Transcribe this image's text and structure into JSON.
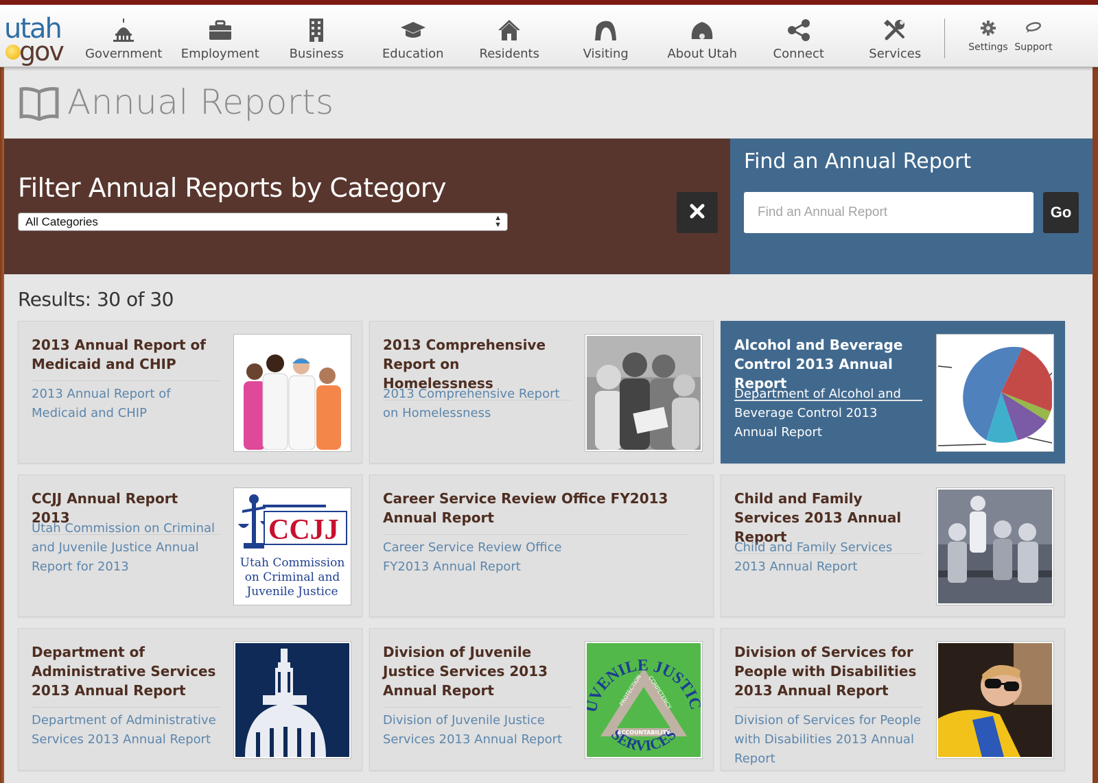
{
  "nav": {
    "items": [
      {
        "label": "Government",
        "icon": "capitol-icon"
      },
      {
        "label": "Employment",
        "icon": "briefcase-icon"
      },
      {
        "label": "Business",
        "icon": "building-icon"
      },
      {
        "label": "Education",
        "icon": "graduation-cap-icon"
      },
      {
        "label": "Residents",
        "icon": "house-icon"
      },
      {
        "label": "Visiting",
        "icon": "arch-icon"
      },
      {
        "label": "About Utah",
        "icon": "beehive-icon"
      },
      {
        "label": "Connect",
        "icon": "share-icon"
      },
      {
        "label": "Services",
        "icon": "tools-icon"
      }
    ],
    "settings_label": "Settings",
    "support_label": "Support"
  },
  "logo": {
    "line1": "utah",
    "line2": "gov"
  },
  "page": {
    "title": "Annual Reports"
  },
  "filter": {
    "heading": "Filter Annual Reports by Category",
    "selected": "All Categories"
  },
  "search": {
    "heading": "Find an Annual Report",
    "placeholder": "Find an Annual Report",
    "go_label": "Go"
  },
  "results": {
    "count_text": "Results: 30 of 30",
    "cards": [
      {
        "title": "2013 Annual Report of Medicaid and CHIP",
        "description": "2013 Annual Report of Medicaid and CHIP",
        "image": "medical-staff-photo"
      },
      {
        "title": "2013 Comprehensive Report on Homelessness",
        "description": "2013 Comprehensive Report on Homelessness",
        "image": "children-reading-photo"
      },
      {
        "title": "Alcohol and Beverage Control 2013 Annual Report",
        "description": "Department of Alcohol and Beverage Control 2013 Annual Report",
        "image": "pie-chart-image"
      },
      {
        "title": "CCJJ Annual Report 2013",
        "description": "Utah Commission on Criminal and Juvenile Justice Annual Report for 2013",
        "image": "ccjj-logo"
      },
      {
        "title": "Career Service Review Office FY2013 Annual Report",
        "description": "Career Service Review Office FY2013 Annual Report",
        "image": ""
      },
      {
        "title": "Child and Family Services 2013 Annual Report",
        "description": "Child and Family Services 2013 Annual Report",
        "image": "family-photo"
      },
      {
        "title": "Department of Administrative Services 2013 Annual Report",
        "description": "Department of Administrative Services 2013 Annual Report",
        "image": "capitol-dome-image"
      },
      {
        "title": "Division of Juvenile Justice Services 2013 Annual Report",
        "description": "Division of Juvenile Justice Services 2013 Annual Report",
        "image": "juvenile-justice-logo"
      },
      {
        "title": "Division of Services for People with Disabilities 2013 Annual Report",
        "description": "Division of Services for People with Disabilities 2013 Annual Report",
        "image": "child-with-sunglasses-photo"
      }
    ],
    "ccjj_logo": {
      "abbr": "CCJJ",
      "lines": [
        "Utah Commission",
        "on Criminal and",
        "Juvenile Justice"
      ]
    },
    "jjs_logo": {
      "top": "JUVENILE JUSTICE",
      "bottom": "SERVICES",
      "side_left": "PROTECTION",
      "side_right": "COMPETENCY",
      "base": "ACCOUNTABILITY"
    }
  },
  "colors": {
    "brand_red": "#7e1a14",
    "filter_bg": "#58362e",
    "search_bg": "#41698e",
    "link_blue": "#5c86ac",
    "title_brown": "#4e2e22"
  }
}
